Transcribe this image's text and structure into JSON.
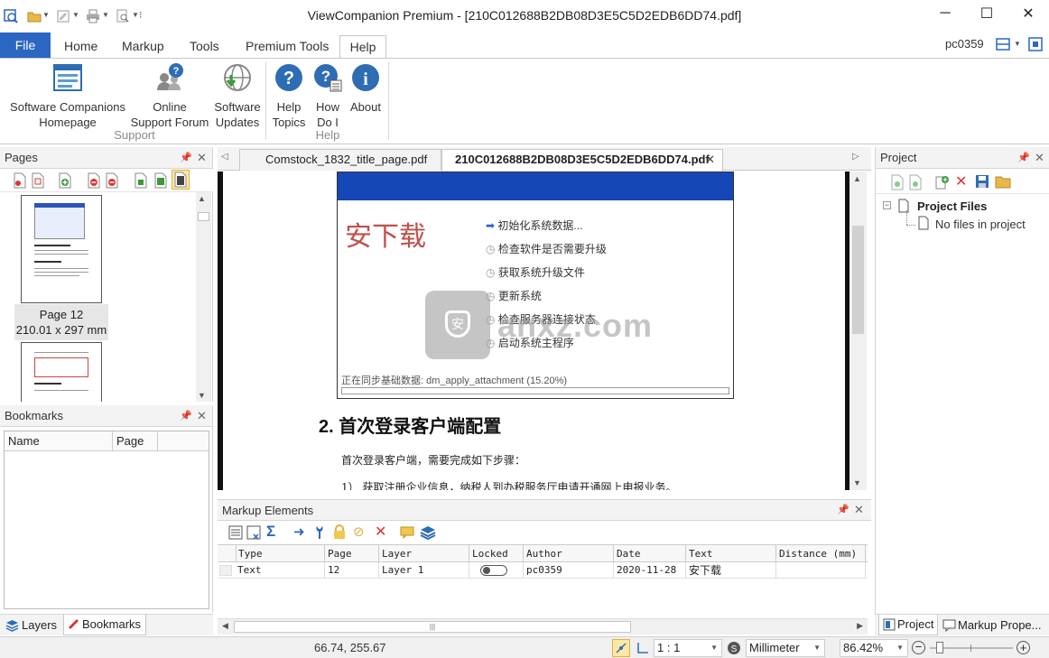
{
  "window": {
    "title": "ViewCompanion Premium - [210C012688B2DB08D3E5C5D2EDB6DD74.pdf]",
    "minimize": "─",
    "maximize": "☐",
    "close": "✕"
  },
  "ribbon_tabs": [
    "File",
    "Home",
    "Markup",
    "Tools",
    "Premium Tools",
    "Help"
  ],
  "active_tab": "Help",
  "user": "pc0359",
  "ribbon": {
    "support_group": "Support",
    "help_group": "Help",
    "buttons": {
      "homepage": {
        "line1": "Software Companions",
        "line2": "Homepage"
      },
      "forum": {
        "line1": "Online",
        "line2": "Support Forum"
      },
      "updates": {
        "line1": "Software",
        "line2": "Updates"
      },
      "help_topics": {
        "line1": "Help",
        "line2": "Topics"
      },
      "how_do_i": {
        "line1": "How",
        "line2": "Do I"
      },
      "about": {
        "line1": "About"
      }
    }
  },
  "pages_panel": {
    "title": "Pages",
    "page_label": "Page 12",
    "page_size": "210.01 x 297 mm"
  },
  "bookmarks_panel": {
    "title": "Bookmarks",
    "columns": [
      "Name",
      "Page"
    ]
  },
  "left_tabs": {
    "layers": "Layers",
    "bookmarks": "Bookmarks"
  },
  "doc_tabs": [
    "Comstock_1832_title_page.pdf",
    "210C012688B2DB08D3E5C5D2EDB6DD74.pdf"
  ],
  "document": {
    "big_text": "安下载",
    "steps": [
      "初始化系统数据...",
      "检查软件是否需要升级",
      "获取系统升级文件",
      "更新系统",
      "检查服务器连接状态",
      "启动系统主程序"
    ],
    "status": "正在同步基础数据: dm_apply_attachment (15.20%)",
    "heading": "2. 首次登录客户端配置",
    "para1": "首次登录客户端，需要完成如下步骤：",
    "para2": "1）  获取注册企业信息，纳税人到办税服务厅申请开通网上申报业务。",
    "watermark": "anxz.com"
  },
  "markup_panel": {
    "title": "Markup Elements",
    "columns": [
      "Type",
      "Page",
      "Layer",
      "Locked",
      "Author",
      "Date",
      "Text",
      "Distance (mm)"
    ],
    "rows": [
      {
        "type": "Text",
        "page": "12",
        "layer": "Layer 1",
        "locked": false,
        "author": "pc0359",
        "date": "2020-11-28",
        "text": "安下载",
        "distance": ""
      }
    ]
  },
  "project_panel": {
    "title": "Project",
    "root": "Project Files",
    "child": "No files in project"
  },
  "right_tabs": {
    "project": "Project",
    "markup_props": "Markup Prope..."
  },
  "status_bar": {
    "coords": "66.74, 255.67",
    "scale": "1 : 1",
    "units": "Millimeter",
    "zoom": "86.42%"
  },
  "colors": {
    "accent": "#2b66c2",
    "help_icon": "#2e6db4"
  }
}
